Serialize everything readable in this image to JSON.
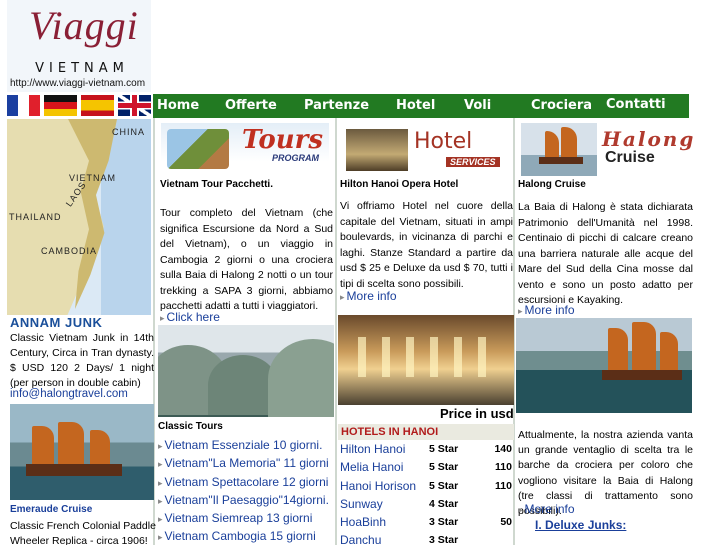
{
  "logo": {
    "title": "Viaggi",
    "subtitle": "VIETNAM",
    "url": "http://www.viaggi-vietnam.com"
  },
  "flags": [
    "flag-france-icon",
    "flag-germany-icon",
    "flag-spain-icon",
    "flag-uk-icon"
  ],
  "nav": {
    "items": [
      "Home",
      "Offerte",
      "Partenze",
      "Hotel",
      "Voli",
      "Crociera",
      "Contatti"
    ]
  },
  "map": {
    "labels": [
      "CHINA",
      "VIETNAM",
      "LAOS",
      "THAILAND",
      "CAMBODIA"
    ]
  },
  "annam": {
    "title": "ANNAM JUNK",
    "description": "Classic Vietnam Junk in 14th Century, Circa in Tran dynasty. $ USD 120 2 Days/ 1 night (per person in double cabin)",
    "email": "info@halongtravel.com"
  },
  "emeraude": {
    "title": "Emeraude Cruise",
    "description": "Classic French Colonial Paddle Wheeler Replica - circa 1906!"
  },
  "tours": {
    "banner_title": "Tours",
    "banner_subtitle": "PROGRAM",
    "heading": "Vietnam Tour Pacchetti.",
    "body": "Tour completo del Vietnam (che significa Escursione da Nord a Sud del Vietnam), o un viaggio in Cambogia 2 giorni o una crociera sulla Baia di Halong 2 notti o un tour trekking a SAPA 3 giorni, abbiamo pacchetti adatti a tutti i viaggiatori.",
    "more": "Click here",
    "classic_heading": "Classic Tours",
    "list": [
      "Vietnam Essenziale  10 giorni.",
      "Vietnam\"La Memoria\" 11 giorni",
      "Vietnam Spettacolare 12 giorni",
      "Vietnam\"Il Paesaggio\"14giorni.",
      "Vietnam Siemreap  13 giorni",
      "Vietnam Cambogia 15 giorni"
    ]
  },
  "hotel": {
    "banner_title": "Hotel",
    "banner_subtitle": "SERVICES",
    "heading": "Hilton Hanoi Opera Hotel",
    "body": "Vi offriamo Hotel nel cuore della capitale del Vietnam, situati in ampi boulevards, in vicinanza di parchi e laghi. Stanze Standard a partire da usd $ 25 e Deluxe da usd $ 70, tutti i tipi di scelta sono possibili.",
    "more": "More info",
    "price_title": "Price in usd",
    "list_heading": "HOTELS IN HANOI",
    "rows": [
      {
        "name": "Hilton Hanoi",
        "stars": "5 Star",
        "price": "140"
      },
      {
        "name": "Melia Hanoi",
        "stars": "5 Star",
        "price": "110"
      },
      {
        "name": "Hanoi Horison",
        "stars": "5 Star",
        "price": "110"
      },
      {
        "name": "Sunway",
        "stars": "4 Star",
        "price": ""
      },
      {
        "name": "HoaBinh",
        "stars": "3 Star",
        "price": "50"
      },
      {
        "name": "Danchu",
        "stars": "3 Star",
        "price": ""
      }
    ]
  },
  "halong": {
    "banner_title": "Halong",
    "banner_subtitle": "Cruise",
    "heading": "Halong Cruise",
    "body": "La Baia di Halong è stata dichiarata Patrimonio dell'Umanità nel 1998. Centinaio di picchi di calcare creano una barriera naturale alle acque del Mare del Sud della Cina mosse dal vento e sono un posto adatto per escursioni e Kayaking.",
    "more": "More info",
    "body2": "Attualmente, la nostra azienda vanta un grande ventaglio di scelta tra le barche da crociera per coloro che vogliono visitare la Baia di Halong (tre classi di trattamento sono possibili).",
    "more2": "More info",
    "deluxe": "I. Deluxe Junks:"
  }
}
